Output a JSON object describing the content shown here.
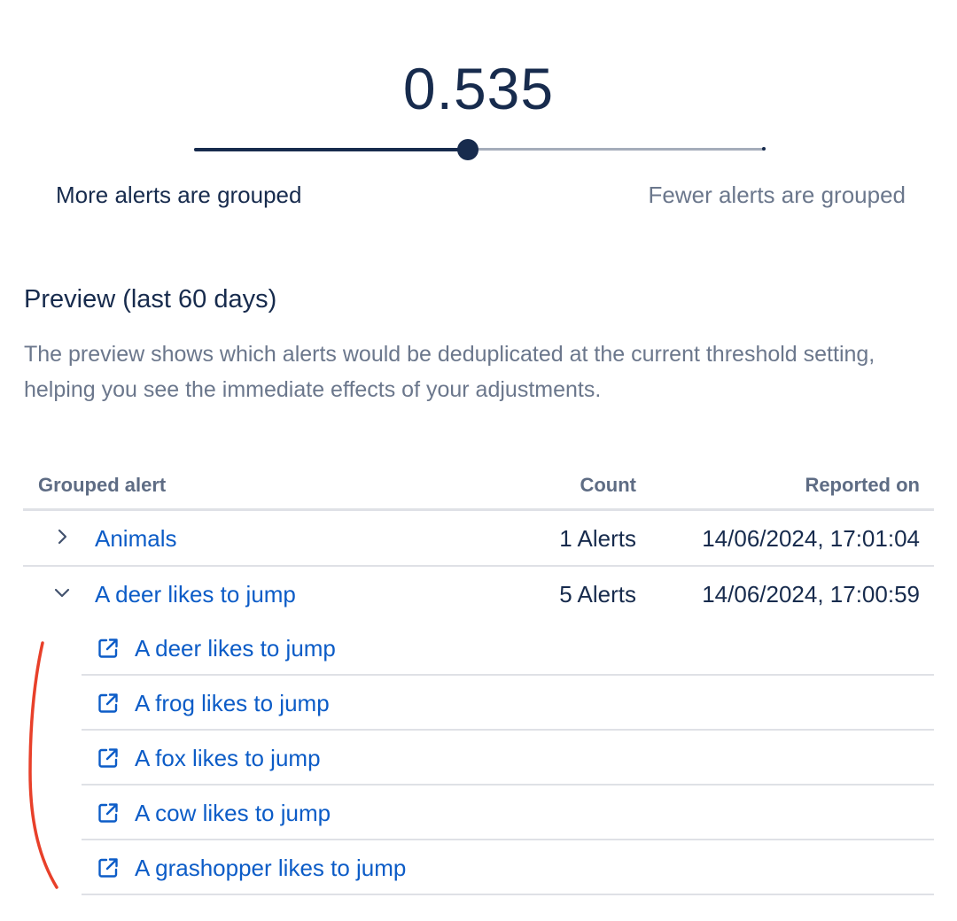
{
  "threshold": {
    "value": "0.535",
    "slider_fraction": 0.48,
    "label_left": "More alerts are grouped",
    "label_right": "Fewer alerts are grouped"
  },
  "preview": {
    "title": "Preview (last 60 days)",
    "description": "The preview shows which alerts would be deduplicated at the current threshold setting, helping you see the immediate effects of your adjustments."
  },
  "table": {
    "headers": {
      "grouped_alert": "Grouped alert",
      "count": "Count",
      "reported_on": "Reported on"
    },
    "rows": [
      {
        "name": "Animals",
        "count": "1 Alerts",
        "reported_on": "14/06/2024, 17:01:04",
        "expanded": false
      },
      {
        "name": "A deer likes to jump",
        "count": "5 Alerts",
        "reported_on": "14/06/2024, 17:00:59",
        "expanded": true,
        "children": [
          "A deer likes to jump",
          "A frog likes to jump",
          "A fox likes to jump",
          "A cow likes to jump",
          "A grashopper likes to jump"
        ]
      }
    ]
  },
  "icons": {
    "collapsed": "chevron-right-icon",
    "expanded": "chevron-down-icon",
    "link": "external-link-icon"
  },
  "colors": {
    "primary_text": "#172b4d",
    "muted_text": "#6b778c",
    "link": "#0c5cc7",
    "annotation": "#e8402a"
  }
}
